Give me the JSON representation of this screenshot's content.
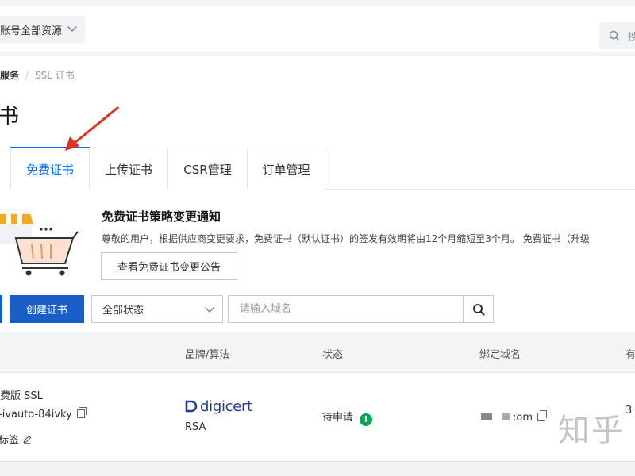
{
  "topbar": {
    "scope_select_label": "账号全部资源",
    "search_placeholder": "搜"
  },
  "breadcrumb": {
    "parent": "服务",
    "current": "SSL 证书"
  },
  "page": {
    "title": "书"
  },
  "tabs": [
    {
      "label": "免费证书",
      "active": true
    },
    {
      "label": "上传证书",
      "active": false
    },
    {
      "label": "CSR管理",
      "active": false
    },
    {
      "label": "订单管理",
      "active": false
    }
  ],
  "notice": {
    "title": "免费证书策略变更通知",
    "text": "尊敬的用户，根据供应商变更要求，免费证书（默认证书）的签发有效期将由12个月缩短至3个月。 免费证书（升级",
    "button_label": "查看免费证书变更公告"
  },
  "toolbar": {
    "create_label": "创建证书",
    "status_selected": "全部状态",
    "domain_placeholder": "请输入域名"
  },
  "table": {
    "headers": {
      "brand": "品牌/算法",
      "status": "状态",
      "domain": "绑定域名",
      "expiry": "有"
    },
    "rows": [
      {
        "name": "费版 SSL",
        "id": "-ivauto-84ivky",
        "tag": "标签",
        "brand": "digicert",
        "algorithm": "RSA",
        "status": "待申请",
        "domain_suffix": ":om",
        "expiry": "3"
      }
    ]
  },
  "watermark": "知乎",
  "colors": {
    "accent": "#006eff",
    "primary_button": "#1a5fc7",
    "status_green": "#0aa65a",
    "annotation_red": "#e0301e"
  }
}
